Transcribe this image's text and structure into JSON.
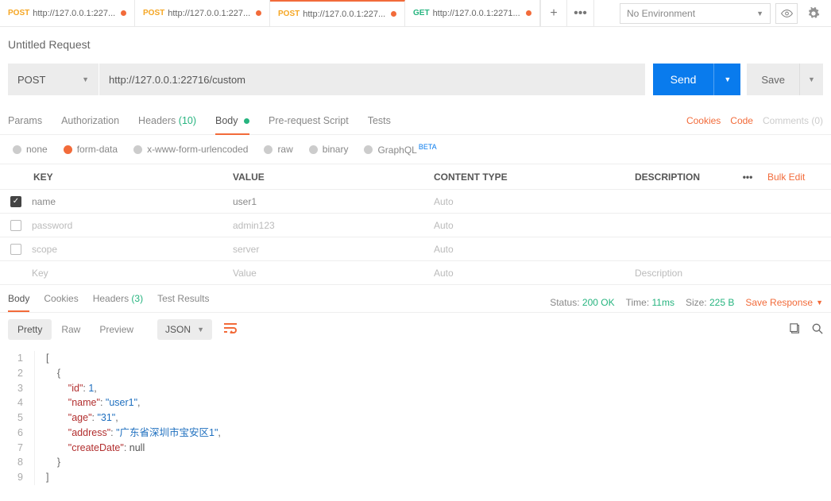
{
  "topbar": {
    "tabs": [
      {
        "method": "POST",
        "methodCls": "method-post",
        "url": "http://127.0.0.1:227...",
        "active": false
      },
      {
        "method": "POST",
        "methodCls": "method-post",
        "url": "http://127.0.0.1:227...",
        "active": false
      },
      {
        "method": "POST",
        "methodCls": "method-post",
        "url": "http://127.0.0.1:227...",
        "active": true
      },
      {
        "method": "GET",
        "methodCls": "method-get",
        "url": "http://127.0.0.1:2271...",
        "active": false
      }
    ],
    "env": "No Environment"
  },
  "request": {
    "name": "Untitled Request",
    "method": "POST",
    "url": "http://127.0.0.1:22716/custom",
    "sendLabel": "Send",
    "saveLabel": "Save"
  },
  "reqtabs": {
    "params": "Params",
    "auth": "Authorization",
    "headers": "Headers",
    "headersCount": "(10)",
    "body": "Body",
    "prescript": "Pre-request Script",
    "tests": "Tests",
    "cookies": "Cookies",
    "code": "Code",
    "comments": "Comments (0)"
  },
  "bodytypes": {
    "none": "none",
    "formdata": "form-data",
    "urlenc": "x-www-form-urlencoded",
    "raw": "raw",
    "binary": "binary",
    "graphql": "GraphQL",
    "beta": "BETA"
  },
  "kv": {
    "head": {
      "key": "KEY",
      "value": "VALUE",
      "ct": "CONTENT TYPE",
      "desc": "DESCRIPTION",
      "bulk": "Bulk Edit",
      "more": "•••"
    },
    "rows": [
      {
        "checked": true,
        "key": "name",
        "value": "user1",
        "ct": "Auto"
      },
      {
        "checked": false,
        "key": "password",
        "value": "admin123",
        "ct": "Auto"
      },
      {
        "checked": false,
        "key": "scope",
        "value": "server",
        "ct": "Auto"
      }
    ],
    "ph": {
      "key": "Key",
      "value": "Value",
      "ct": "Auto",
      "desc": "Description"
    }
  },
  "response": {
    "tabs": {
      "body": "Body",
      "cookies": "Cookies",
      "headers": "Headers",
      "hcount": "(3)",
      "tests": "Test Results"
    },
    "statusLbl": "Status:",
    "status": "200 OK",
    "timeLbl": "Time:",
    "time": "11ms",
    "sizeLbl": "Size:",
    "size": "225 B",
    "save": "Save Response"
  },
  "viewbar": {
    "pretty": "Pretty",
    "raw": "Raw",
    "preview": "Preview",
    "fmt": "JSON"
  },
  "json": {
    "l1": "[",
    "l2": "    {",
    "l3a": "        \"id\"",
    "l3b": ": ",
    "l3c": "1",
    "l3d": ",",
    "l4a": "        \"name\"",
    "l4b": ": ",
    "l4c": "\"user1\"",
    "l4d": ",",
    "l5a": "        \"age\"",
    "l5b": ": ",
    "l5c": "\"31\"",
    "l5d": ",",
    "l6a": "        \"address\"",
    "l6b": ": ",
    "l6c": "\"广东省深圳市宝安区1\"",
    "l6d": ",",
    "l7a": "        \"createDate\"",
    "l7b": ": ",
    "l7c": "null",
    "l8": "    }",
    "l9": "]"
  }
}
